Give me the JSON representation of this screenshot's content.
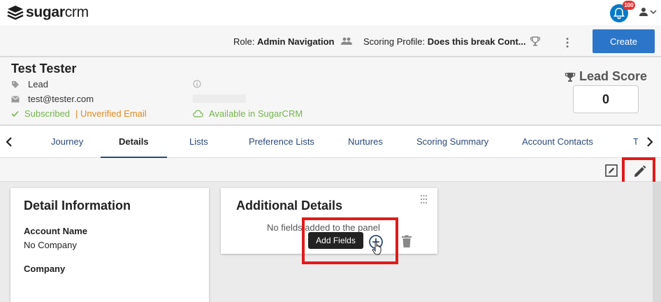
{
  "app": {
    "logo_bold": "sugar",
    "logo_light": "crm",
    "notification_count": "100"
  },
  "subbar": {
    "role_label": "Role:",
    "role_value": "Admin Navigation",
    "scoring_label": "Scoring Profile:",
    "scoring_value": "Does this break Cont...",
    "create_label": "Create"
  },
  "contact": {
    "name": "Test Tester",
    "type": "Lead",
    "email": "test@tester.com",
    "subscribed": "Subscribed",
    "unverified": "| Unverified Email",
    "available": "Available in SugarCRM",
    "lead_score_label": "Lead Score",
    "lead_score_value": "0"
  },
  "tabs": [
    "Journey",
    "Details",
    "Lists",
    "Preference Lists",
    "Nurtures",
    "Scoring Summary",
    "Account Contacts",
    "T"
  ],
  "active_tab": "Details",
  "detail_card": {
    "title": "Detail Information",
    "fields": [
      {
        "label": "Account Name",
        "value": "No Company"
      },
      {
        "label": "Company",
        "value": ""
      }
    ]
  },
  "additional_card": {
    "title": "Additional Details",
    "empty_text": "No fields added to the panel",
    "tooltip": "Add Fields"
  },
  "colors": {
    "brand_blue": "#2c76c9",
    "bell_blue": "#0679c8",
    "badge_red": "#e3342f",
    "highlight_red": "#e01b1b",
    "success_green": "#74b54c",
    "warning_orange": "#e08a1f"
  }
}
